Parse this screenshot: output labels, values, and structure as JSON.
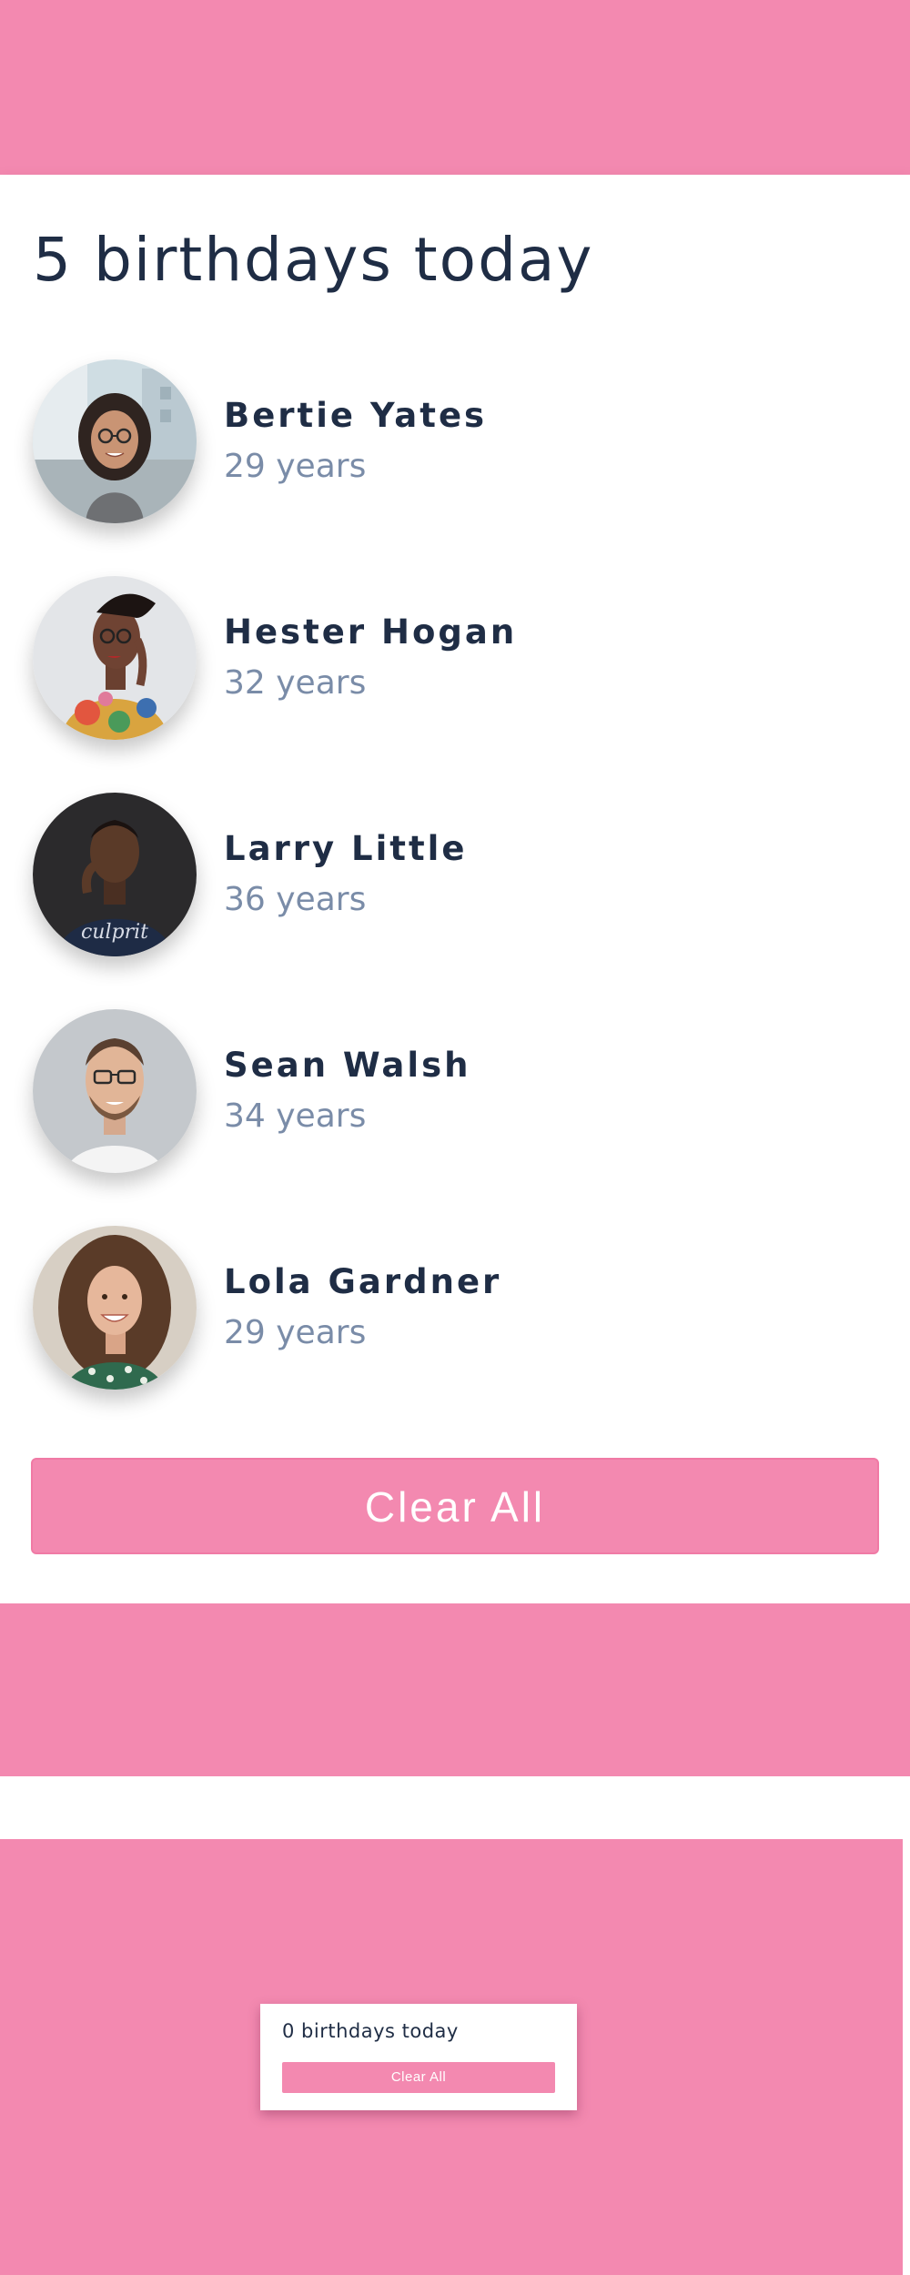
{
  "colors": {
    "accent": "#f389b0",
    "title_text": "#1f2d45",
    "age_text": "#7a8ca8",
    "card_background": "#ffffff"
  },
  "birthday_list": {
    "title": "5 birthdays today",
    "people": [
      {
        "name": "Bertie Yates",
        "age": "29 years",
        "avatar": "woman-glasses-street-photo"
      },
      {
        "name": "Hester Hogan",
        "age": "32 years",
        "avatar": "woman-glasses-braids-photo"
      },
      {
        "name": "Larry Little",
        "age": "36 years",
        "avatar": "man-navy-tshirt-photo"
      },
      {
        "name": "Sean Walsh",
        "age": "34 years",
        "avatar": "man-glasses-beard-photo"
      },
      {
        "name": "Lola Gardner",
        "age": "29 years",
        "avatar": "woman-curly-hair-photo"
      }
    ],
    "clear_label": "Clear All"
  },
  "empty_state": {
    "title": "0 birthdays today",
    "clear_label": "Clear All"
  }
}
